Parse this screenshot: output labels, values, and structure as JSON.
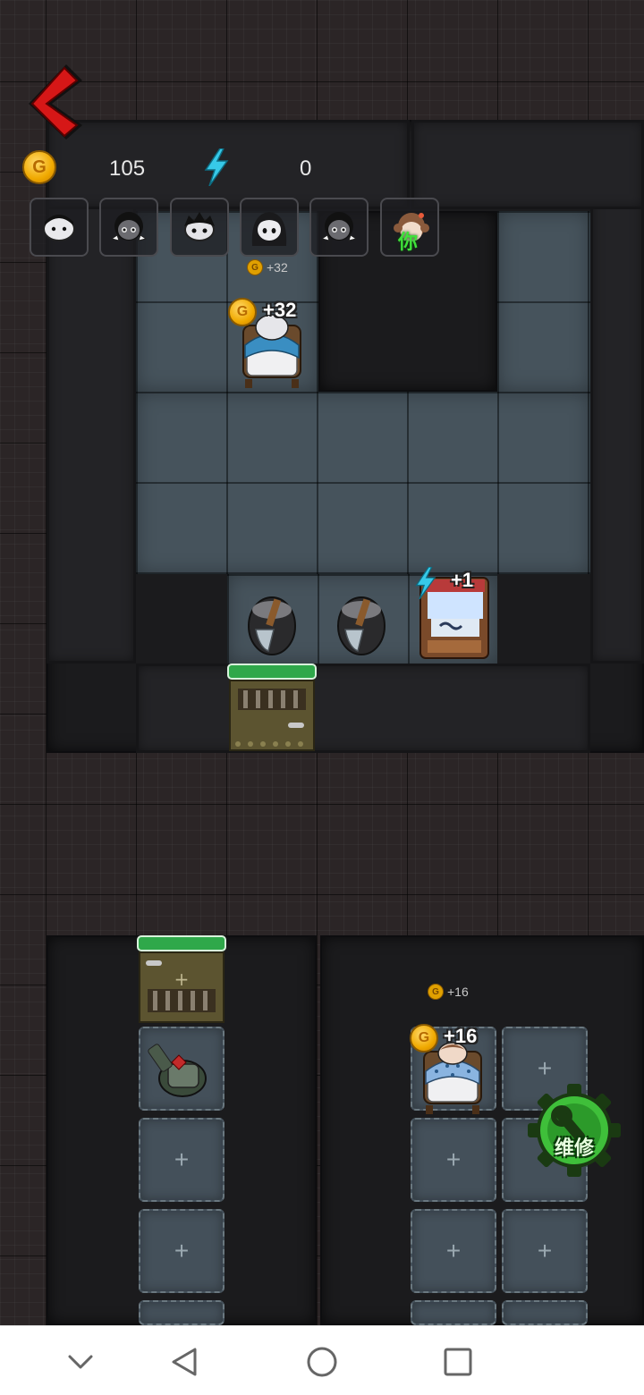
{
  "hud": {
    "gold_value": "105",
    "coin_glyph": "G",
    "energy_value": "0"
  },
  "avatars": [
    {
      "name": "ghost-kid-avatar"
    },
    {
      "name": "pigtail-girl-avatar"
    },
    {
      "name": "spiky-kid-avatar"
    },
    {
      "name": "long-hair-ghost-avatar"
    },
    {
      "name": "pigtail-girl-avatar-2"
    },
    {
      "name": "you-avatar",
      "label": "你"
    }
  ],
  "room_top": {
    "mini_gain": "+32",
    "bed_gain": "+32",
    "arcade_gain": "+1"
  },
  "room_bottom_right": {
    "mini_gain": "+16",
    "bed_gain": "+16"
  },
  "slot_plus": "+",
  "repair": {
    "label": "维修"
  },
  "colors": {
    "hp_bar": "#2fa84a",
    "coin": "#f0a900",
    "energy": "#37c9e8",
    "repair": "#3fbf3a"
  },
  "icons": [
    "back-arrow-icon",
    "coin-icon",
    "lightning-icon",
    "wrench-gear-icon",
    "nav-down-icon",
    "nav-back-icon",
    "nav-home-icon",
    "nav-recents-icon"
  ]
}
